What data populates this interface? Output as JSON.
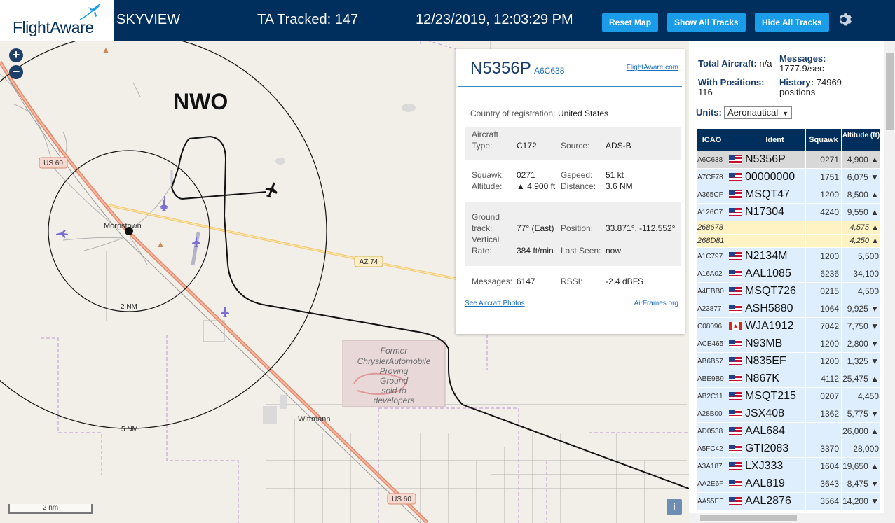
{
  "header": {
    "logo": "FlightAware",
    "site_name": "SKYVIEW",
    "tracked": "TA Tracked: 147",
    "datetime": "12/23/2019, 12:03:29 PM",
    "buttons": {
      "reset_map": "Reset Map",
      "show_all": "Show All Tracks",
      "hide_all": "Hide All Tracks"
    },
    "icons": {
      "settings": "gear-icon",
      "logo": "plane-icon"
    }
  },
  "map": {
    "zoom_in": "+",
    "zoom_out": "−",
    "site_label": "NWO",
    "ring_labels": [
      "2 NM",
      "5 NM"
    ],
    "places": [
      "Morristown",
      "Wittmann"
    ],
    "roads": [
      "US 60",
      "AZ 74",
      "US 60"
    ],
    "landmark": [
      "Former",
      "ChryslerAutomobile",
      "Proving",
      "Ground",
      "sold to",
      "developers"
    ],
    "scale": "2 nm",
    "info": "i",
    "colors": {
      "track": "#111111",
      "highway": "#e9967a",
      "aircraft_selected": "#000000",
      "aircraft_other": "#7a6fd0"
    }
  },
  "popup": {
    "callsign": "N5356P",
    "icao": "A6C638",
    "link_fa": "FlightAware.com",
    "country_label": "Country of registration:",
    "country": "United States",
    "aircraft_type_label_1": "Aircraft",
    "aircraft_type_label_2": "Type:",
    "aircraft_type": "C172",
    "source_label": "Source:",
    "source": "ADS-B",
    "squawk_label": "Squawk:",
    "squawk": "0271",
    "gspeed_label": "Gspeed:",
    "gspeed": "51 kt",
    "altitude_label": "Altitude:",
    "altitude": "▲ 4,900 ft",
    "distance_label": "Distance:",
    "distance": "3.6 NM",
    "track_label_1": "Ground",
    "track_label_2": "track:",
    "track": "77° (East)",
    "position_label": "Position:",
    "position": "33.871°, -112.552°",
    "vrate_label_1": "Vertical",
    "vrate_label_2": "Rate:",
    "vrate": "384 ft/min",
    "lastseen_label": "Last Seen:",
    "lastseen": "now",
    "messages_label": "Messages:",
    "messages": "6147",
    "rssi_label": "RSSI:",
    "rssi": "-2.4 dBFS",
    "photos_link": "See Aircraft Photos",
    "airframes_link": "AirFrames.org"
  },
  "sidebar": {
    "total_label": "Total Aircraft:",
    "total": "n/a",
    "messages_label": "Messages:",
    "messages": "1777.9/sec",
    "withpos_label": "With Positions:",
    "withpos": "116",
    "history_label": "History:",
    "history": "74969",
    "history_unit": "positions",
    "units_label": "Units:",
    "units_value": "Aeronautical",
    "columns": [
      "ICAO",
      "Ident",
      "Squawk",
      "Altitude (ft)"
    ],
    "rows": [
      {
        "icao": "A6C638",
        "flag": "us",
        "ident": "N5356P",
        "squawk": "0271",
        "alt": "4,900 ▲",
        "sel": true
      },
      {
        "icao": "A7CF78",
        "flag": "us",
        "ident": "00000000",
        "squawk": "1751",
        "alt": "6,075 ▼"
      },
      {
        "icao": "A365CF",
        "flag": "us",
        "ident": "MSQT47",
        "squawk": "1200",
        "alt": "8,500 ▲"
      },
      {
        "icao": "A126C7",
        "flag": "us",
        "ident": "N17304",
        "squawk": "4240",
        "alt": "9,550 ▲"
      },
      {
        "icao": "268678",
        "flag": "",
        "ident": "",
        "squawk": "",
        "alt": "4,575 ▲",
        "nopos": true
      },
      {
        "icao": "268D81",
        "flag": "",
        "ident": "",
        "squawk": "",
        "alt": "4,250 ▲",
        "nopos": true
      },
      {
        "icao": "A1C797",
        "flag": "us",
        "ident": "N2134M",
        "squawk": "1200",
        "alt": "5,500"
      },
      {
        "icao": "A16A02",
        "flag": "us",
        "ident": "AAL1085",
        "squawk": "6236",
        "alt": "34,100"
      },
      {
        "icao": "A4EBB0",
        "flag": "us",
        "ident": "MSQT726",
        "squawk": "0215",
        "alt": "4,500"
      },
      {
        "icao": "A23877",
        "flag": "us",
        "ident": "ASH5880",
        "squawk": "1064",
        "alt": "9,925 ▼"
      },
      {
        "icao": "C08096",
        "flag": "ca",
        "ident": "WJA1912",
        "squawk": "7042",
        "alt": "7,750 ▼"
      },
      {
        "icao": "ACE465",
        "flag": "us",
        "ident": "N93MB",
        "squawk": "1200",
        "alt": "2,800 ▼"
      },
      {
        "icao": "AB6B57",
        "flag": "us",
        "ident": "N835EF",
        "squawk": "1200",
        "alt": "1,325 ▼"
      },
      {
        "icao": "ABE9B9",
        "flag": "us",
        "ident": "N867K",
        "squawk": "4112",
        "alt": "25,475 ▲"
      },
      {
        "icao": "AB2C11",
        "flag": "us",
        "ident": "MSQT215",
        "squawk": "0207",
        "alt": "4,450"
      },
      {
        "icao": "A28B00",
        "flag": "us",
        "ident": "JSX408",
        "squawk": "1362",
        "alt": "5,775 ▼"
      },
      {
        "icao": "AD0538",
        "flag": "us",
        "ident": "AAL684",
        "squawk": "",
        "alt": "26,000 ▲"
      },
      {
        "icao": "A5FC42",
        "flag": "us",
        "ident": "GTI2083",
        "squawk": "3370",
        "alt": "28,000"
      },
      {
        "icao": "A3A187",
        "flag": "us",
        "ident": "LXJ333",
        "squawk": "1604",
        "alt": "19,650 ▲"
      },
      {
        "icao": "AA2E6F",
        "flag": "us",
        "ident": "AAL819",
        "squawk": "3643",
        "alt": "8,475 ▼"
      },
      {
        "icao": "AA55EE",
        "flag": "us",
        "ident": "AAL2876",
        "squawk": "3564",
        "alt": "14,200 ▼"
      }
    ]
  }
}
